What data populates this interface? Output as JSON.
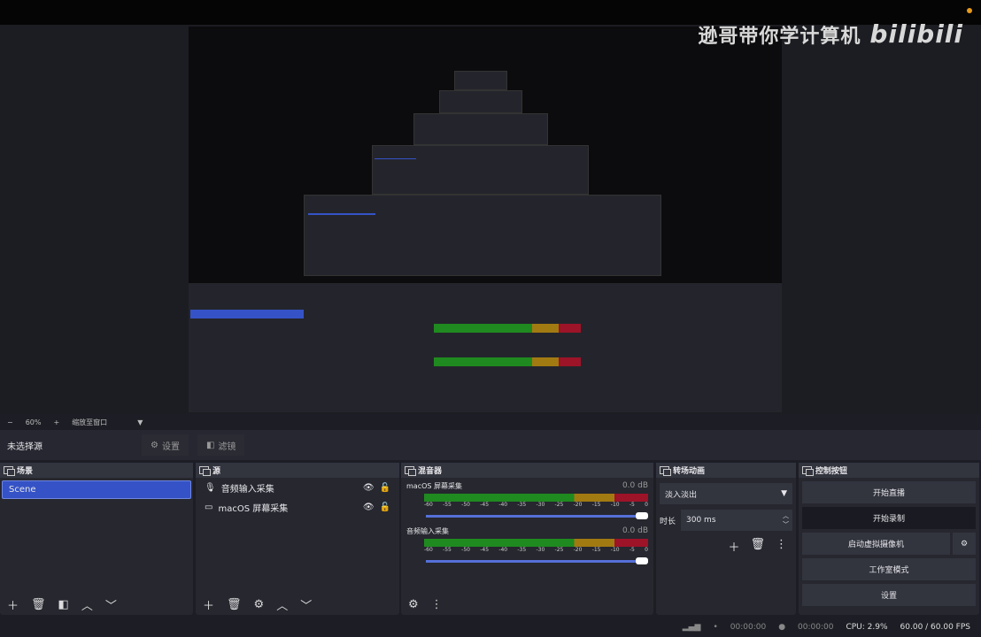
{
  "watermark": {
    "text": "逊哥带你学计算机",
    "brand": "bilibili"
  },
  "zoom": {
    "minus": "−",
    "value": "60%",
    "plus": "+",
    "mode": "缩放至窗口"
  },
  "source_toolbar": {
    "title": "未选择源",
    "settings": "设置",
    "filters": "滤镜"
  },
  "scenes": {
    "title": "场景",
    "items": [
      "Scene"
    ]
  },
  "sources": {
    "title": "源",
    "items": [
      "音频输入采集",
      "macOS 屏幕采集"
    ]
  },
  "mixer": {
    "title": "混音器",
    "channels": [
      {
        "name": "macOS 屏幕采集",
        "db": "0.0 dB",
        "volume": 1.0
      },
      {
        "name": "音频输入采集",
        "db": "0.0 dB",
        "volume": 1.0
      }
    ],
    "ticks": [
      "-60",
      "-55",
      "-50",
      "-45",
      "-40",
      "-35",
      "-30",
      "-25",
      "-20",
      "-15",
      "-10",
      "-5",
      "0"
    ]
  },
  "transitions": {
    "title": "转场动画",
    "selected": "淡入淡出",
    "duration_label": "时长",
    "duration": "300 ms"
  },
  "controls": {
    "title": "控制按钮",
    "start_stream": "开始直播",
    "start_record": "开始录制",
    "virtual_cam": "启动虚拟摄像机",
    "studio_mode": "工作室模式",
    "settings": "设置"
  },
  "status": {
    "stream_time": "00:00:00",
    "record_time": "00:00:00",
    "cpu": "CPU: 2.9%",
    "fps": "60.00 / 60.00 FPS"
  },
  "colors": {
    "accent": "#3553c6",
    "meter_green": "#1f8a1f",
    "meter_yellow": "#a27a12",
    "meter_red": "#9d1328"
  }
}
